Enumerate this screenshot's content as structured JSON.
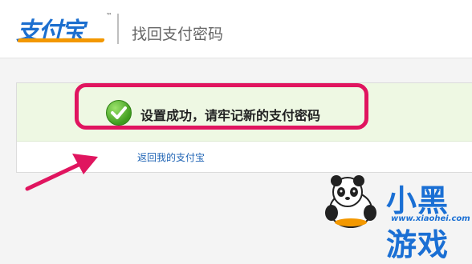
{
  "header": {
    "logo_text": "支付宝",
    "logo_tm": "™",
    "title": "找回支付密码"
  },
  "main": {
    "success_message": "设置成功，请牢记新的支付密码",
    "return_link": "返回我的支付宝"
  },
  "watermark": {
    "brand_name": "小黑游戏",
    "brand_url": "www.xiaohei.com"
  },
  "colors": {
    "highlight": "#e0155f",
    "success_bg": "#eef8e3",
    "link": "#2165b5",
    "logo_blue": "#1c6fcf",
    "logo_orange": "#f39800"
  },
  "icons": [
    "check-icon",
    "arrow-annotation-icon",
    "panda-mascot-icon"
  ]
}
